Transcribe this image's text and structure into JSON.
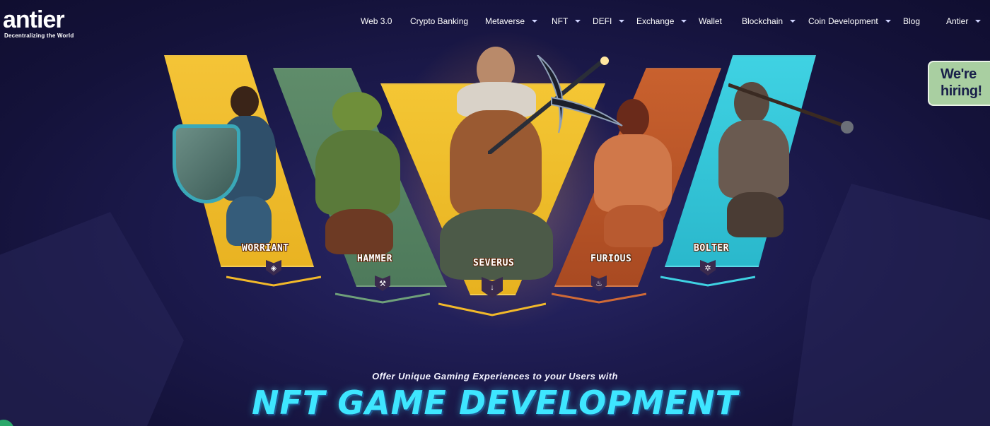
{
  "brand": {
    "name": "antier",
    "tagline": "Decentralizing the World"
  },
  "nav": {
    "items": [
      {
        "label": "Web 3.0",
        "has_dropdown": false
      },
      {
        "label": "Crypto Banking",
        "has_dropdown": false
      },
      {
        "label": "Metaverse",
        "has_dropdown": true
      },
      {
        "label": "NFT",
        "has_dropdown": true
      },
      {
        "label": "DEFI",
        "has_dropdown": true
      },
      {
        "label": "Exchange",
        "has_dropdown": true
      },
      {
        "label": "Wallet",
        "has_dropdown": false
      },
      {
        "label": "Blockchain",
        "has_dropdown": true
      },
      {
        "label": "Coin Development",
        "has_dropdown": true
      },
      {
        "label": "Blog",
        "has_dropdown": false
      },
      {
        "label": "Antier",
        "has_dropdown": true
      }
    ]
  },
  "hiring": {
    "line1": "We're",
    "line2": "hiring!"
  },
  "characters": [
    {
      "name": "WORRIANT",
      "panel_color": "#f4c437",
      "icon": "shield-emblem-icon"
    },
    {
      "name": "HAMMER",
      "panel_color": "#5f8c6a",
      "icon": "hammer-emblem-icon"
    },
    {
      "name": "SEVERUS",
      "panel_color": "#f4c634",
      "icon": "sword-emblem-icon"
    },
    {
      "name": "FURIOUS",
      "panel_color": "#c9612e",
      "icon": "flame-emblem-icon"
    },
    {
      "name": "BOLTER",
      "panel_color": "#3fd2e3",
      "icon": "gear-emblem-icon"
    }
  ],
  "hero": {
    "subtitle": "Offer Unique Gaming Experiences to your Users with",
    "headline": "NFT GAME DEVELOPMENT"
  },
  "colors": {
    "background": "#1d1b4f",
    "headline": "#3ee6ff",
    "hiring_badge": "#a9cfa1"
  }
}
